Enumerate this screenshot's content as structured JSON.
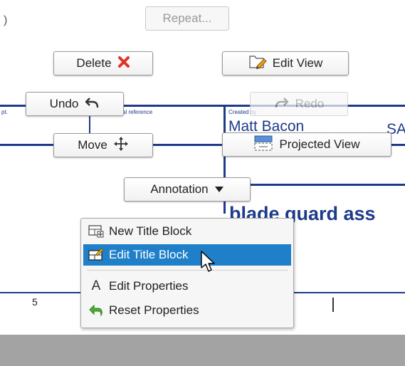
{
  "background": {
    "label_left": "pt.",
    "label_ref": "al reference",
    "label_created": "Created by",
    "name_partial": "Matt Bacon",
    "code_partial": "SA",
    "title_partial": "blade guard ass",
    "col_number": "5"
  },
  "marking_menu": {
    "repeat": "Repeat...",
    "delete": "Delete",
    "edit_view": "Edit View",
    "undo": "Undo",
    "redo": "Redo",
    "move": "Move",
    "projected_view": "Projected View",
    "annotation": "Annotation"
  },
  "context_menu": {
    "items": [
      {
        "label": "New Title Block",
        "icon": "new-title-block-icon",
        "highlighted": false
      },
      {
        "label": "Edit Title Block",
        "icon": "edit-title-block-icon",
        "highlighted": true
      },
      {
        "label": "Edit Properties",
        "icon": "letter-a-icon",
        "highlighted": false
      },
      {
        "label": "Reset Properties",
        "icon": "reset-green-arrow-icon",
        "highlighted": false
      }
    ]
  },
  "colors": {
    "drawing_lines": "#1e3a8a",
    "highlight": "#1f7fc8",
    "delete_x": "#e0322a",
    "status_bar": "#a3a3a3"
  }
}
